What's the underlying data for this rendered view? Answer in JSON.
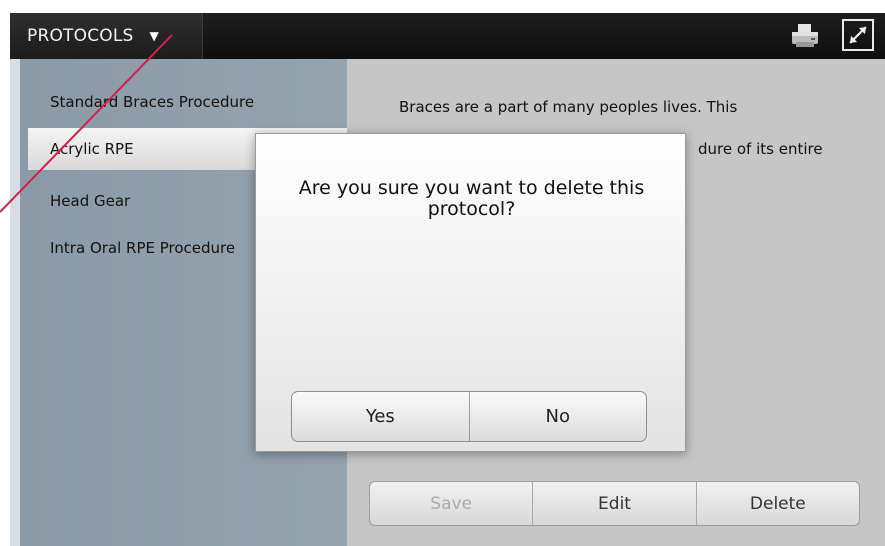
{
  "header": {
    "menu_label": "PROTOCOLS",
    "menu_caret": "▼",
    "print_icon": "printer-icon",
    "expand_icon": "expand-icon"
  },
  "sidebar": {
    "items": [
      {
        "label": "Standard Braces Procedure"
      },
      {
        "label": "Acrylic RPE"
      },
      {
        "label": "Head Gear"
      },
      {
        "label": "Intra Oral RPE Procedure"
      }
    ],
    "selected_index": 1
  },
  "content": {
    "line1": "Braces are a part of many peoples lives. This",
    "line2": "dure of its entire"
  },
  "actions": {
    "save_label": "Save",
    "edit_label": "Edit",
    "delete_label": "Delete"
  },
  "dialog": {
    "message": "Are you sure you want to delete this protocol?",
    "yes_label": "Yes",
    "no_label": "No"
  },
  "colors": {
    "topbar": "#141414",
    "sidebar": "#8f9ea9",
    "annotation": "#d21f4c"
  }
}
